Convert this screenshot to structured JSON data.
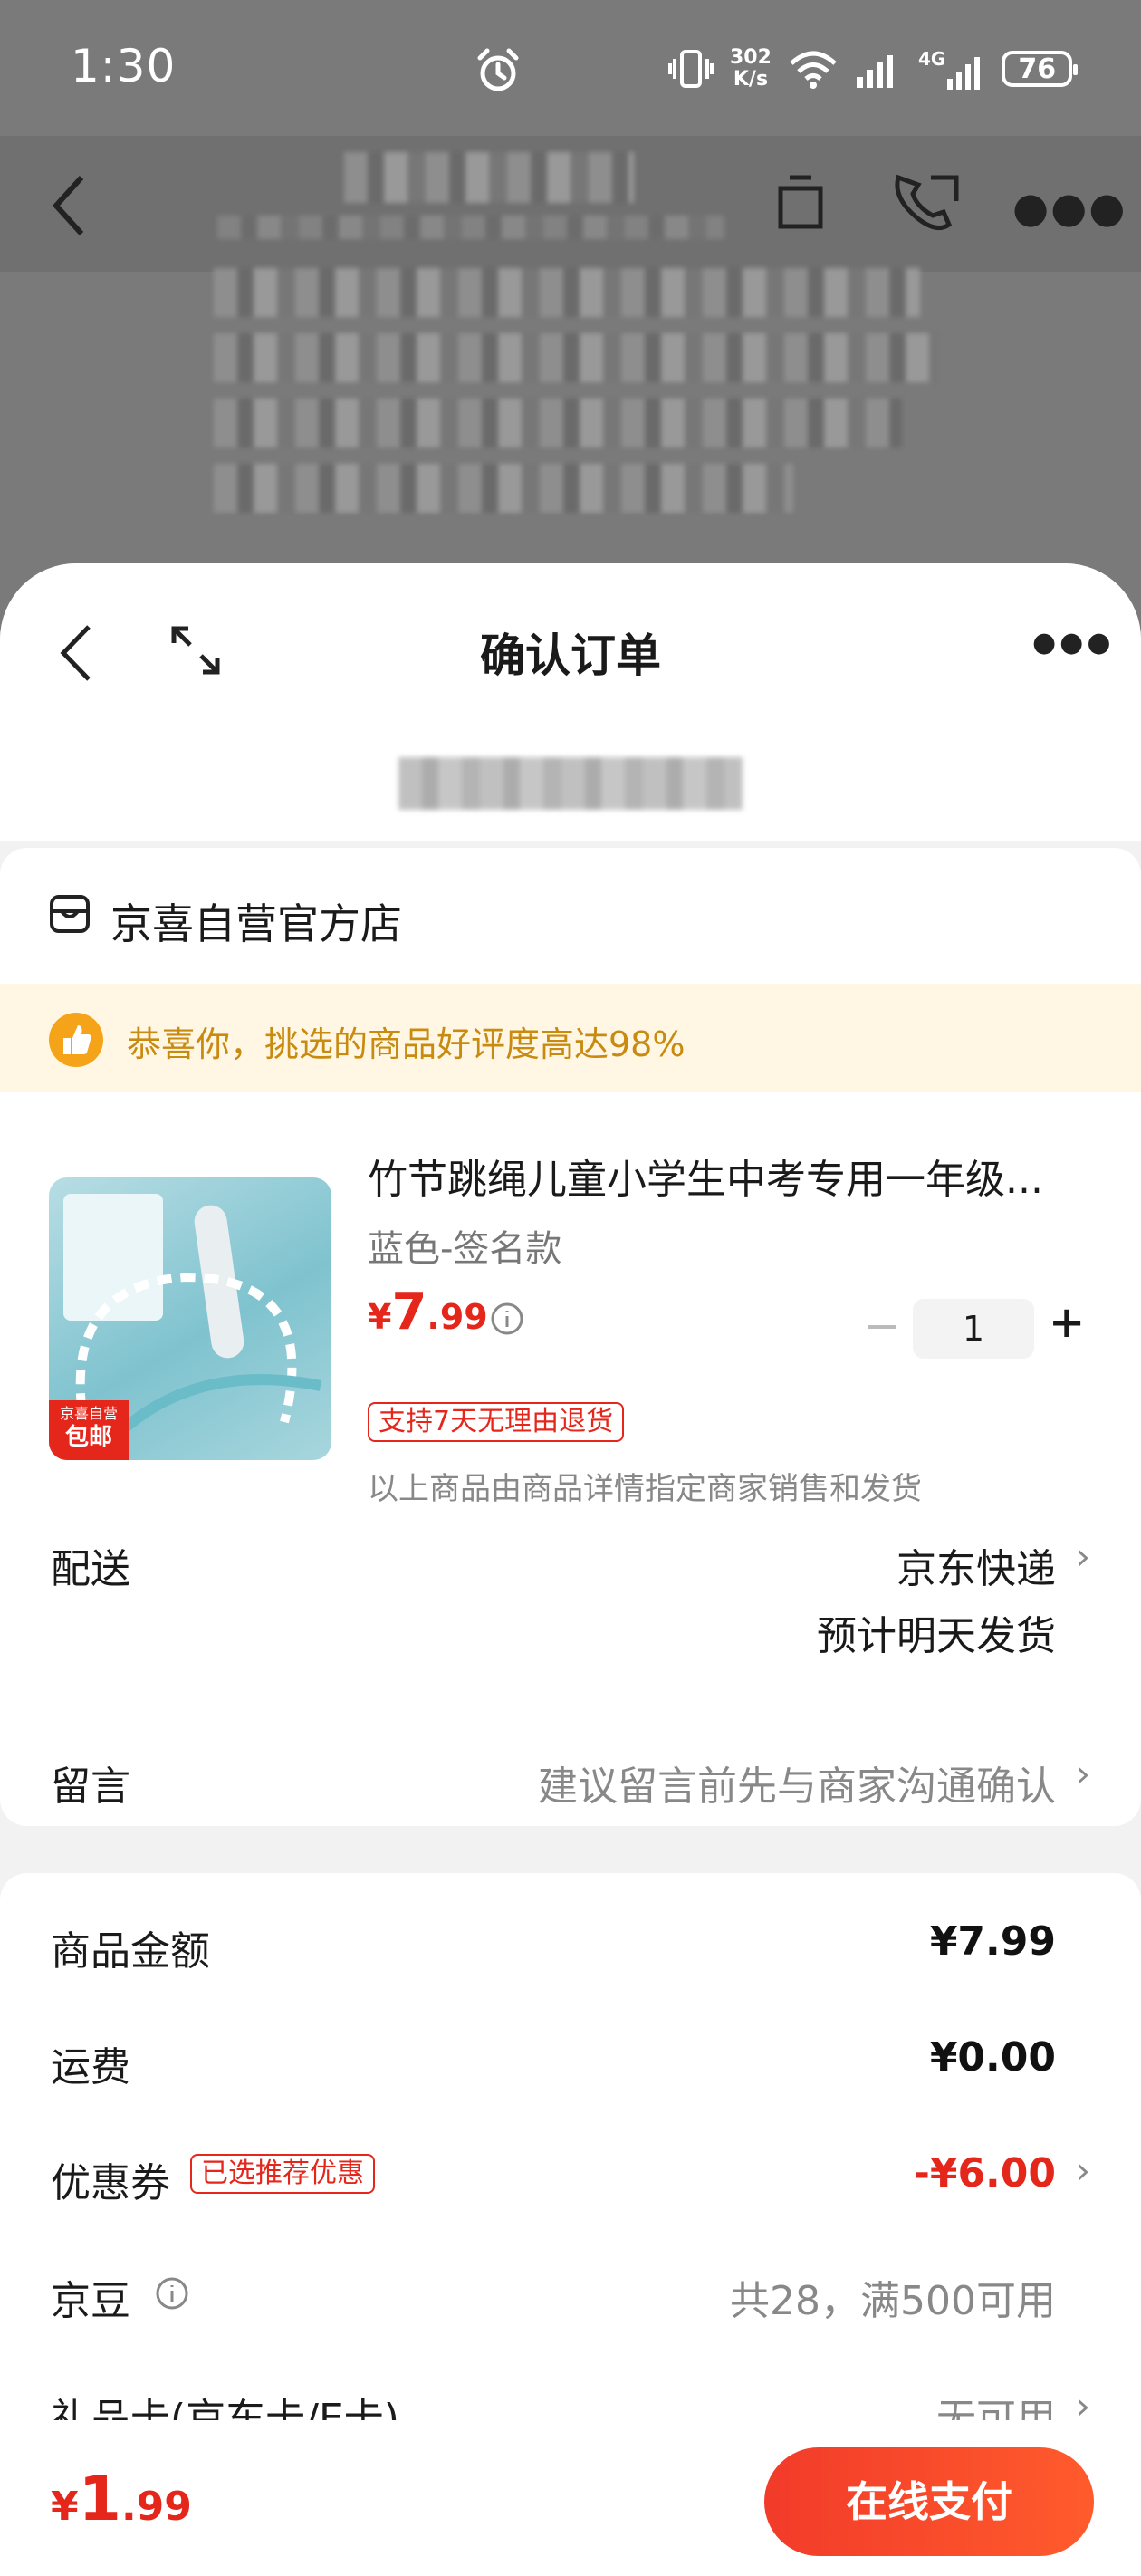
{
  "status_bar": {
    "time": "1:30",
    "net_speed_value": "302",
    "net_speed_unit": "K/s",
    "battery": "76",
    "mobile_network": "4G"
  },
  "order": {
    "title": "确认订单",
    "store_name": "京喜自营官方店",
    "promo_text": "恭喜你，挑选的商品好评度高达98%",
    "product": {
      "title": "竹节跳绳儿童小学生中考专用一年级...",
      "spec": "蓝色-签名款",
      "price_symbol": "¥",
      "price_int": "7",
      "price_dec": ".99",
      "quantity": "1",
      "minus": "−",
      "plus": "+",
      "return_tag": "支持7天无理由退货",
      "seller_note": "以上商品由商品详情指定商家销售和发货",
      "image_badge_top": "京喜自营",
      "image_badge_bottom": "包邮"
    },
    "delivery": {
      "label": "配送",
      "method": "京东快递",
      "eta": "预计明天发货"
    },
    "message": {
      "label": "留言",
      "placeholder": "建议留言前先与商家沟通确认"
    }
  },
  "summary": {
    "goods_amount": {
      "label": "商品金额",
      "value": "¥7.99"
    },
    "shipping": {
      "label": "运费",
      "value": "¥0.00"
    },
    "coupon": {
      "label": "优惠券",
      "tag": "已选推荐优惠",
      "value": "-¥6.00"
    },
    "jd_beans": {
      "label": "京豆",
      "value": "共28，满500可用"
    },
    "gift_card": {
      "label": "礼品卡(京东卡/E卡)",
      "value": "无可用"
    }
  },
  "footer": {
    "total_symbol": "¥",
    "total_int": "1",
    "total_dec": ".99",
    "pay_label": "在线支付"
  },
  "colors": {
    "accent_red": "#e4261b",
    "promo_gold": "#c98a10",
    "promo_bg": "#fff7e3"
  }
}
